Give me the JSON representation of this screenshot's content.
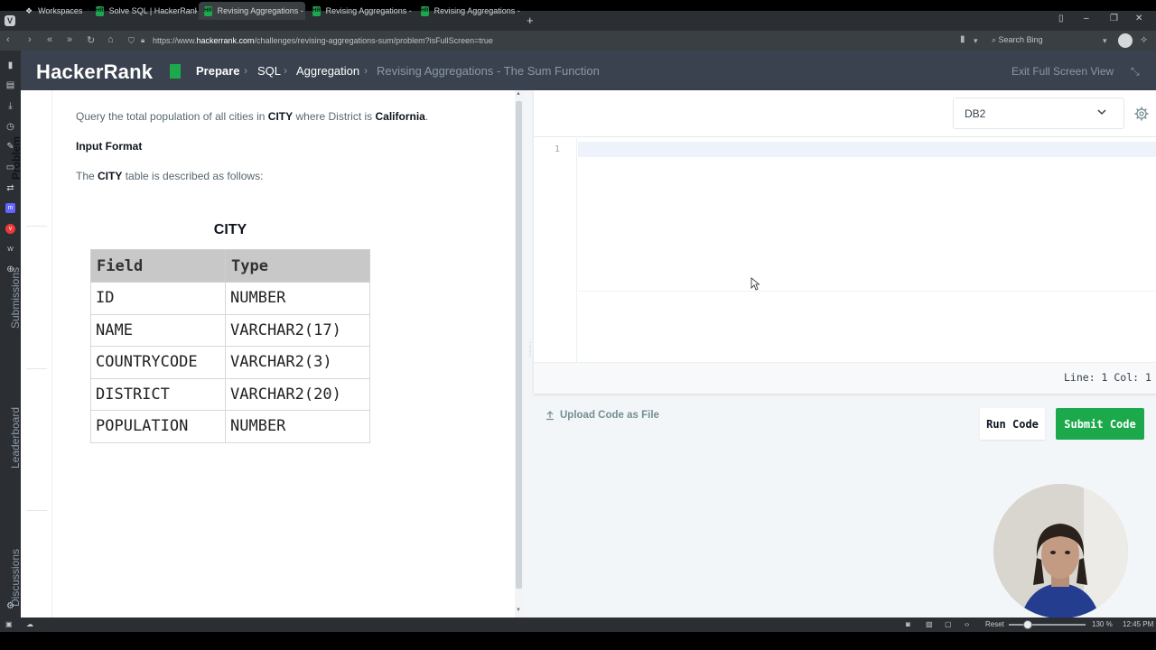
{
  "browser": {
    "workspaces_label": "Workspaces",
    "tabs": [
      {
        "label": "Solve SQL | HackerRank"
      },
      {
        "label": "Revising Aggregations - Th"
      },
      {
        "label": "Revising Aggregations - Th"
      },
      {
        "label": "Revising Aggregations - Av"
      }
    ],
    "url_prefix": "https://www.",
    "url_host": "hackerrank.com",
    "url_path": "/challenges/revising-aggregations-sum/problem?isFullScreen=true",
    "search_placeholder": "Search Bing"
  },
  "header": {
    "logo": "HackerRank",
    "brand_color": "#1ba94c",
    "breadcrumbs": [
      "Prepare",
      "SQL",
      "Aggregation",
      "Revising Aggregations - The Sum Function"
    ],
    "exit_fullscreen": "Exit Full Screen View"
  },
  "side_tabs": [
    "Problem",
    "Submissions",
    "Leaderboard",
    "Discussions"
  ],
  "problem": {
    "q_pre": "Query the total population of all cities in ",
    "q_city": "CITY",
    "q_mid": " where District is ",
    "q_ca": "California",
    "q_end": ".",
    "input_format": "Input Format",
    "desc_pre": "The ",
    "desc_city": "CITY",
    "desc_post": " table is described as follows:",
    "table_title": "CITY",
    "table_headers": [
      "Field",
      "Type"
    ],
    "table_rows": [
      [
        "ID",
        "NUMBER"
      ],
      [
        "NAME",
        "VARCHAR2(17)"
      ],
      [
        "COUNTRYCODE",
        "VARCHAR2(3)"
      ],
      [
        "DISTRICT",
        "VARCHAR2(20)"
      ],
      [
        "POPULATION",
        "NUMBER"
      ]
    ]
  },
  "editor": {
    "language": "DB2",
    "line_number": "1",
    "status": "Line: 1 Col: 1",
    "upload_label": "Upload Code as File",
    "run_label": "Run Code",
    "submit_label": "Submit Code"
  },
  "statusbar": {
    "reset": "Reset",
    "zoom": "130 %",
    "time": "12:45 PM"
  }
}
